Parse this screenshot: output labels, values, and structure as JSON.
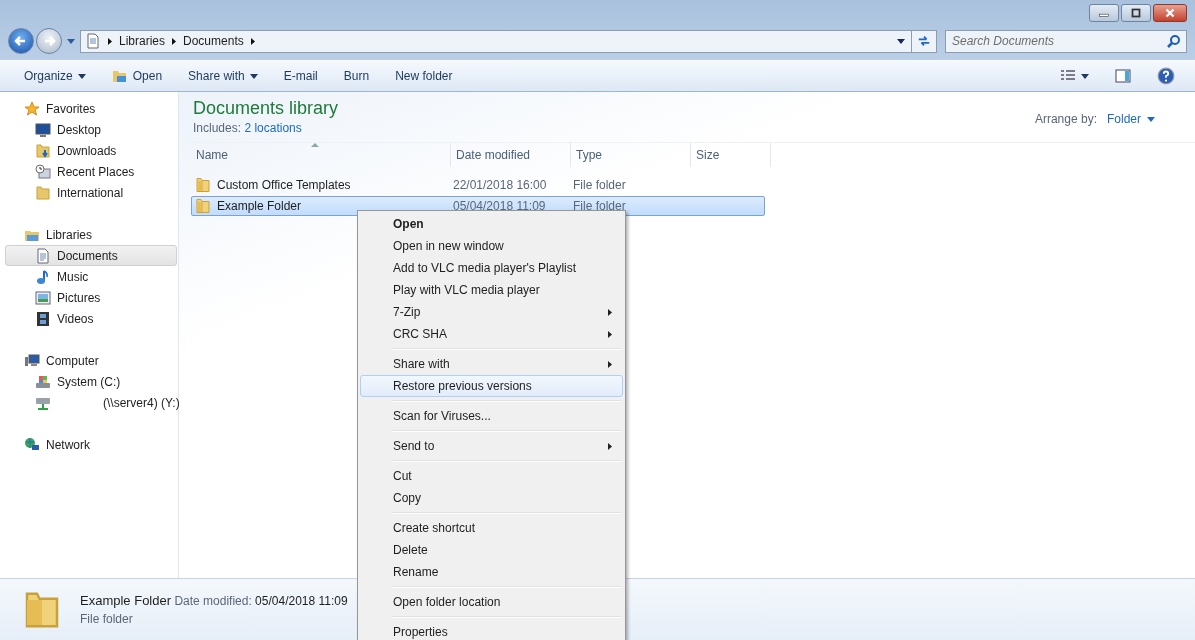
{
  "address_bar": {
    "crumbs": [
      "Libraries",
      "Documents"
    ]
  },
  "search": {
    "placeholder": "Search Documents"
  },
  "toolbar": {
    "items": [
      {
        "label": "Organize",
        "dropdown": true
      },
      {
        "label": "Open",
        "dropdown": false
      },
      {
        "label": "Share with",
        "dropdown": true
      },
      {
        "label": "E-mail",
        "dropdown": false
      },
      {
        "label": "Burn",
        "dropdown": false
      },
      {
        "label": "New folder",
        "dropdown": false
      }
    ]
  },
  "sidebar": {
    "groups": [
      {
        "label": "Favorites",
        "children": [
          {
            "label": "Desktop",
            "selected": false
          },
          {
            "label": "Downloads",
            "selected": false
          },
          {
            "label": "Recent Places",
            "selected": false
          },
          {
            "label": "International",
            "selected": false
          }
        ]
      },
      {
        "label": "Libraries",
        "children": [
          {
            "label": "Documents",
            "selected": true
          },
          {
            "label": "Music",
            "selected": false
          },
          {
            "label": "Pictures",
            "selected": false
          },
          {
            "label": "Videos",
            "selected": false
          }
        ]
      },
      {
        "label": "Computer",
        "children": [
          {
            "label": "System (C:)",
            "selected": false
          },
          {
            "label": "(\\\\server4) (Y:)",
            "selected": false
          }
        ]
      },
      {
        "label": "Network"
      }
    ]
  },
  "library": {
    "title": "Documents library",
    "includes_label": "Includes:",
    "includes_link": "2 locations",
    "arrange_label": "Arrange by:",
    "arrange_value": "Folder"
  },
  "table": {
    "columns": [
      "Name",
      "Date modified",
      "Type",
      "Size"
    ],
    "rows": [
      {
        "name": "Custom Office Templates",
        "date": "22/01/2018 16:00",
        "type": "File folder",
        "selected": false
      },
      {
        "name": "Example Folder",
        "date": "05/04/2018 11:09",
        "type": "File folder",
        "selected": true
      }
    ]
  },
  "context_menu": {
    "items": [
      {
        "kind": "item",
        "label": "Open",
        "default": true,
        "submenu": false,
        "selected": false
      },
      {
        "kind": "item",
        "label": "Open in new window",
        "default": false,
        "submenu": false,
        "selected": false
      },
      {
        "kind": "item",
        "label": "Add to VLC media player's Playlist",
        "default": false,
        "submenu": false,
        "selected": false
      },
      {
        "kind": "item",
        "label": "Play with VLC media player",
        "default": false,
        "submenu": false,
        "selected": false
      },
      {
        "kind": "item",
        "label": "7-Zip",
        "default": false,
        "submenu": true,
        "selected": false
      },
      {
        "kind": "item",
        "label": "CRC SHA",
        "default": false,
        "submenu": true,
        "selected": false
      },
      {
        "kind": "separator"
      },
      {
        "kind": "item",
        "label": "Share with",
        "default": false,
        "submenu": true,
        "selected": false
      },
      {
        "kind": "item",
        "label": "Restore previous versions",
        "default": false,
        "submenu": false,
        "selected": true
      },
      {
        "kind": "separator"
      },
      {
        "kind": "item",
        "label": "Scan for Viruses...",
        "default": false,
        "submenu": false,
        "selected": false
      },
      {
        "kind": "separator"
      },
      {
        "kind": "item",
        "label": "Send to",
        "default": false,
        "submenu": true,
        "selected": false
      },
      {
        "kind": "separator"
      },
      {
        "kind": "item",
        "label": "Cut",
        "default": false,
        "submenu": false,
        "selected": false
      },
      {
        "kind": "item",
        "label": "Copy",
        "default": false,
        "submenu": false,
        "selected": false
      },
      {
        "kind": "separator"
      },
      {
        "kind": "item",
        "label": "Create shortcut",
        "default": false,
        "submenu": false,
        "selected": false
      },
      {
        "kind": "item",
        "label": "Delete",
        "default": false,
        "submenu": false,
        "selected": false
      },
      {
        "kind": "item",
        "label": "Rename",
        "default": false,
        "submenu": false,
        "selected": false
      },
      {
        "kind": "separator"
      },
      {
        "kind": "item",
        "label": "Open folder location",
        "default": false,
        "submenu": false,
        "selected": false
      },
      {
        "kind": "separator"
      },
      {
        "kind": "item",
        "label": "Properties",
        "default": false,
        "submenu": false,
        "selected": false
      }
    ]
  },
  "details_pane": {
    "name": "Example Folder",
    "date_label": "Date modified:",
    "date_value": "05/04/2018 11:09",
    "type": "File folder"
  }
}
